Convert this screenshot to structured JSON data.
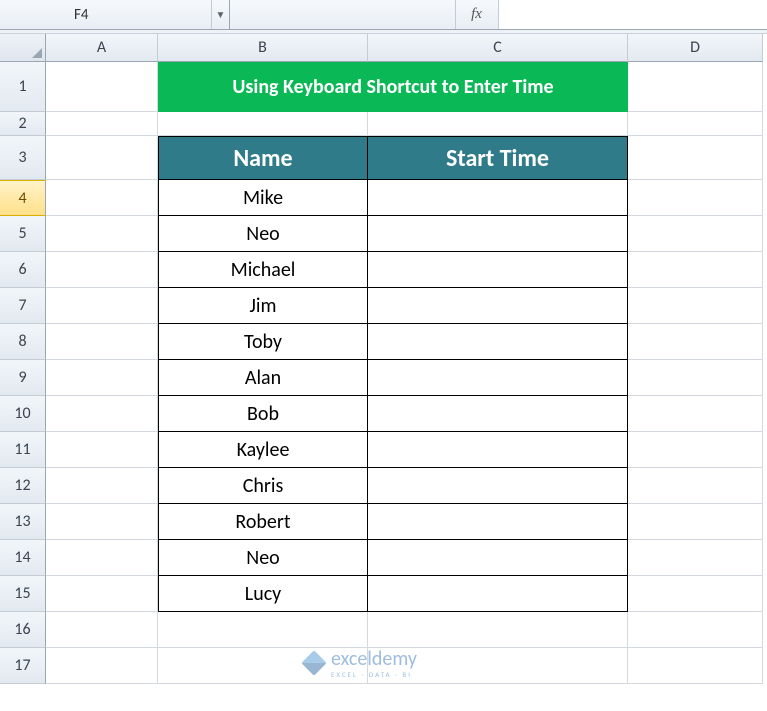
{
  "namebox": {
    "value": "F4"
  },
  "fx": {
    "label": "fx",
    "formula": ""
  },
  "columns": [
    "A",
    "B",
    "C",
    "D"
  ],
  "rows": [
    "1",
    "2",
    "3",
    "4",
    "5",
    "6",
    "7",
    "8",
    "9",
    "10",
    "11",
    "12",
    "13",
    "14",
    "15",
    "16",
    "17"
  ],
  "selected_row_index": 3,
  "title": "Using Keyboard Shortcut to Enter Time",
  "table": {
    "headers": [
      "Name",
      "Start Time"
    ],
    "data": [
      {
        "name": "Mike",
        "start": ""
      },
      {
        "name": "Neo",
        "start": ""
      },
      {
        "name": "Michael",
        "start": ""
      },
      {
        "name": "Jim",
        "start": ""
      },
      {
        "name": "Toby",
        "start": ""
      },
      {
        "name": "Alan",
        "start": ""
      },
      {
        "name": "Bob",
        "start": ""
      },
      {
        "name": "Kaylee",
        "start": ""
      },
      {
        "name": "Chris",
        "start": ""
      },
      {
        "name": "Robert",
        "start": ""
      },
      {
        "name": "Neo",
        "start": ""
      },
      {
        "name": "Lucy",
        "start": ""
      }
    ]
  },
  "watermark": {
    "brand": "exceldemy",
    "tagline": "EXCEL · DATA · BI"
  },
  "chart_data": {
    "type": "table",
    "title": "Using Keyboard Shortcut to Enter Time",
    "columns": [
      "Name",
      "Start Time"
    ],
    "rows": [
      [
        "Mike",
        ""
      ],
      [
        "Neo",
        ""
      ],
      [
        "Michael",
        ""
      ],
      [
        "Jim",
        ""
      ],
      [
        "Toby",
        ""
      ],
      [
        "Alan",
        ""
      ],
      [
        "Bob",
        ""
      ],
      [
        "Kaylee",
        ""
      ],
      [
        "Chris",
        ""
      ],
      [
        "Robert",
        ""
      ],
      [
        "Neo",
        ""
      ],
      [
        "Lucy",
        ""
      ]
    ]
  }
}
